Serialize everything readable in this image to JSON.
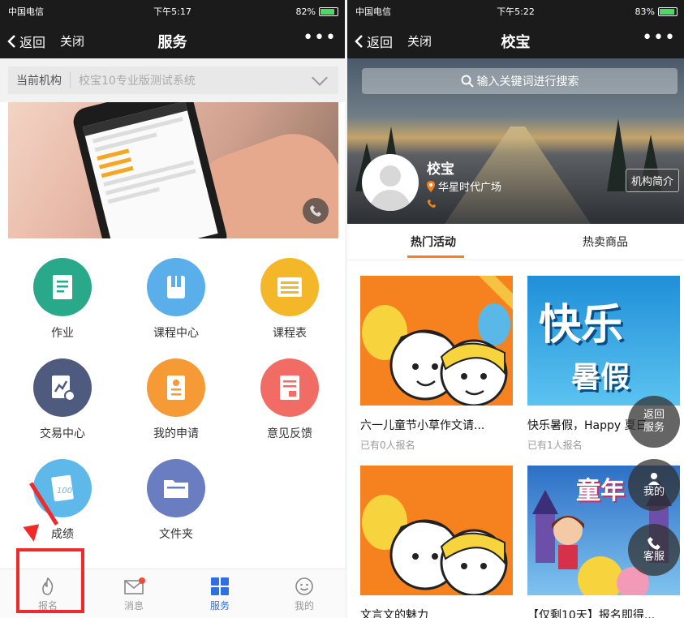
{
  "left": {
    "status": {
      "carrier": "中国电信",
      "time": "下午5:17",
      "battery": "82%"
    },
    "nav": {
      "back": "返回",
      "close": "关闭",
      "title": "服务",
      "more": "•••"
    },
    "org": {
      "label": "当前机构",
      "value": "校宝10专业版测试系统"
    },
    "grid": [
      {
        "label": "作业",
        "color": "#2aa98a",
        "icon": "homework-icon"
      },
      {
        "label": "课程中心",
        "color": "#5aaeea",
        "icon": "course-center-icon"
      },
      {
        "label": "课程表",
        "color": "#f5b72a",
        "icon": "schedule-icon"
      },
      {
        "label": "交易中心",
        "color": "#4e5a7e",
        "icon": "transaction-icon"
      },
      {
        "label": "我的申请",
        "color": "#f59a35",
        "icon": "application-icon"
      },
      {
        "label": "意见反馈",
        "color": "#f06c64",
        "icon": "feedback-icon"
      },
      {
        "label": "成绩",
        "color": "#5fb8ea",
        "icon": "score-icon"
      },
      {
        "label": "文件夹",
        "color": "#6a7dc0",
        "icon": "folder-icon"
      }
    ],
    "tabs": [
      {
        "label": "报名",
        "icon": "flame-icon"
      },
      {
        "label": "消息",
        "icon": "message-icon"
      },
      {
        "label": "服务",
        "icon": "grid-icon"
      },
      {
        "label": "我的",
        "icon": "smile-icon"
      }
    ],
    "active_tab": "服务",
    "highlight_color": "#ee2a2a"
  },
  "right": {
    "status": {
      "carrier": "中国电信",
      "time": "下午5:22",
      "battery": "83%"
    },
    "nav": {
      "back": "返回",
      "close": "关闭",
      "title": "校宝",
      "more": "•••"
    },
    "search_placeholder": "输入关键词进行搜索",
    "shop": {
      "name": "校宝",
      "address": "华星时代广场",
      "intro_button": "机构简介"
    },
    "tabs": [
      {
        "label": "热门活动"
      },
      {
        "label": "热卖商品"
      }
    ],
    "accent": "#f5821f",
    "cards": [
      {
        "title": "六一儿童节小草作文请...",
        "sub": "已有0人报名"
      },
      {
        "title": "快乐暑假，Happy 夏日",
        "sub": "已有1人报名",
        "image_text_1": "快乐",
        "image_text_2": "暑假"
      },
      {
        "title": "文言文的魅力",
        "sub": ""
      },
      {
        "title": "【仅剩10天】报名即得...",
        "sub": "",
        "image_text_1": "童年"
      }
    ],
    "floating": {
      "return": "返回",
      "service": "服务",
      "mine": "我的",
      "support": "客服"
    }
  }
}
